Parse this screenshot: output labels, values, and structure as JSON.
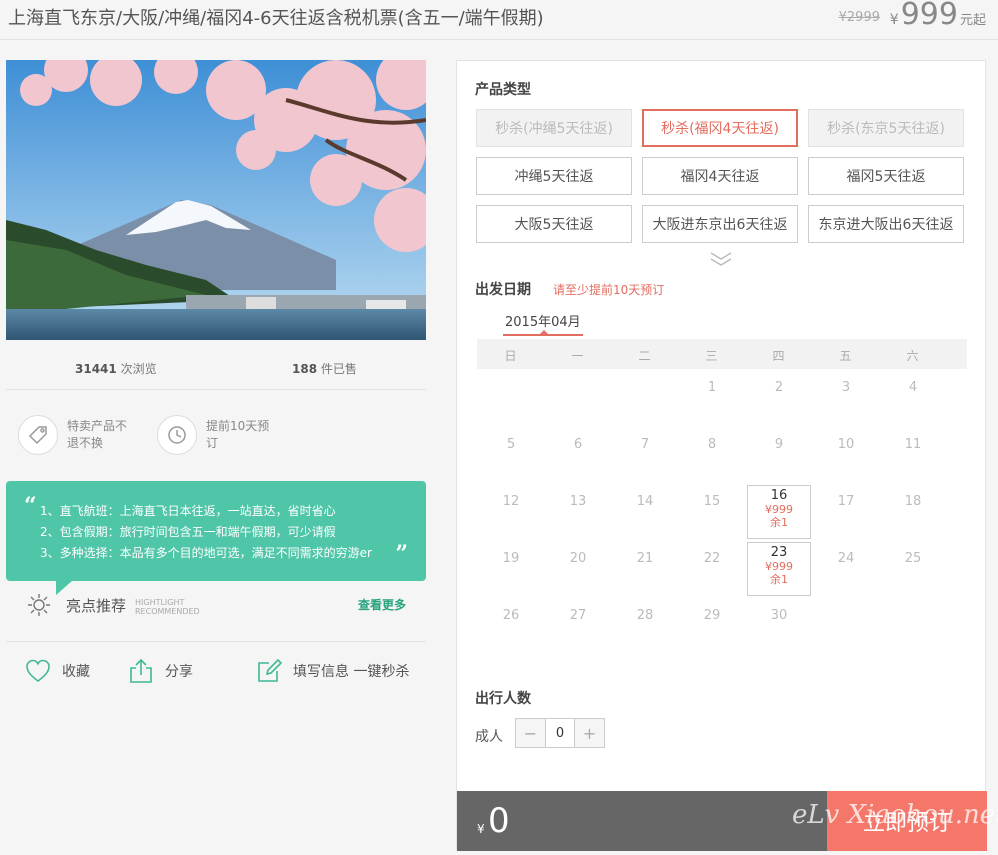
{
  "header": {
    "title": "上海直飞东京/大阪/冲绳/福冈4-6天往返含税机票(含五一/端午假期)",
    "original_price": "¥2999",
    "currency": "¥",
    "price": "999",
    "price_suffix": "元起"
  },
  "stats": {
    "views_count": "31441",
    "views_label": "次浏览",
    "sold_count": "188",
    "sold_label": "件已售"
  },
  "features": [
    {
      "text": "特卖产品不退不换",
      "icon": "tag-icon"
    },
    {
      "text": "提前10天预订",
      "icon": "clock-icon"
    }
  ],
  "highlights": {
    "quote_open": "“",
    "quote_close": "”",
    "lines": [
      "1、直飞航班：上海直飞日本往返，一站直达，省时省心",
      "2、包含假期：旅行时间包含五一和端午假期，可少请假",
      "3、多种选择：本品有多个目的地可选，满足不同需求的穷游er"
    ],
    "title": "亮点推荐",
    "title_en_1": "HIGHTLIGHT",
    "title_en_2": "RECOMMENDED",
    "more": "查看更多"
  },
  "actions": {
    "favorite": "收藏",
    "share": "分享",
    "fill": "填写信息 一键秒杀"
  },
  "product": {
    "section_title": "产品类型",
    "options": [
      {
        "label": "秒杀(冲绳5天往返)",
        "state": "disabled"
      },
      {
        "label": "秒杀(福冈4天往返)",
        "state": "selected"
      },
      {
        "label": "秒杀(东京5天往返)",
        "state": "disabled"
      },
      {
        "label": "冲绳5天往返",
        "state": "normal"
      },
      {
        "label": "福冈4天往返",
        "state": "normal"
      },
      {
        "label": "福冈5天往返",
        "state": "normal"
      },
      {
        "label": "大阪5天往返",
        "state": "normal"
      },
      {
        "label": "大阪进东京出6天往返",
        "state": "normal"
      },
      {
        "label": "东京进大阪出6天往返",
        "state": "normal"
      }
    ]
  },
  "date": {
    "section_title": "出发日期",
    "hint": "请至少提前10天预订",
    "month": "2015年04月",
    "weekdays": [
      "日",
      "一",
      "二",
      "三",
      "四",
      "五",
      "六"
    ],
    "first_weekday": 3,
    "days_in_month": 30,
    "available": {
      "16": {
        "price": "¥999",
        "left": "余1"
      },
      "23": {
        "price": "¥999",
        "left": "余1"
      }
    }
  },
  "travelers": {
    "section_title": "出行人数",
    "adult_label": "成人",
    "minus": "−",
    "plus": "+",
    "adult_count": "0"
  },
  "booking": {
    "currency": "¥",
    "total": "0",
    "button": "立即预订",
    "watermark": "eLv Xiaohou.net"
  },
  "colors": {
    "accent": "#e36d5f",
    "green": "#4fc6a8",
    "book_button": "#f4776a",
    "bar": "#666666"
  }
}
